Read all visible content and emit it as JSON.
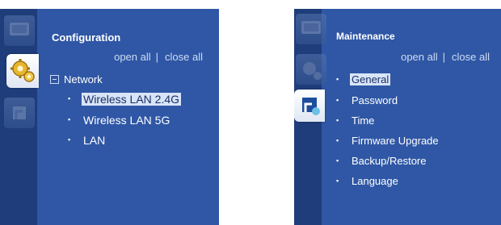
{
  "colors": {
    "panel_bg": "#2f57a5",
    "sidebar_bg": "#1e3d7a",
    "selected_bg": "#d8e4f7",
    "text": "#ffffff"
  },
  "left_panel": {
    "icons": [
      "monitor-icon",
      "gear-cogs-icon",
      "maintenance-icon"
    ],
    "active_icon": "gear-cogs-icon",
    "title": "Configuration",
    "open_all": "open all",
    "separator": "|",
    "close_all": "close all",
    "group": "Network",
    "items": [
      {
        "label": "Wireless LAN 2.4G",
        "selected": true
      },
      {
        "label": "Wireless LAN 5G",
        "selected": false
      },
      {
        "label": "LAN",
        "selected": false
      }
    ]
  },
  "right_panel": {
    "icons": [
      "monitor-icon",
      "gear-cogs-icon",
      "maintenance-icon"
    ],
    "active_icon": "maintenance-icon",
    "title": "Maintenance",
    "open_all": "open all",
    "separator": "|",
    "close_all": "close all",
    "items": [
      {
        "label": "General",
        "selected": true
      },
      {
        "label": "Password",
        "selected": false
      },
      {
        "label": "Time",
        "selected": false
      },
      {
        "label": "Firmware Upgrade",
        "selected": false
      },
      {
        "label": "Backup/Restore",
        "selected": false
      },
      {
        "label": "Language",
        "selected": false
      }
    ]
  }
}
